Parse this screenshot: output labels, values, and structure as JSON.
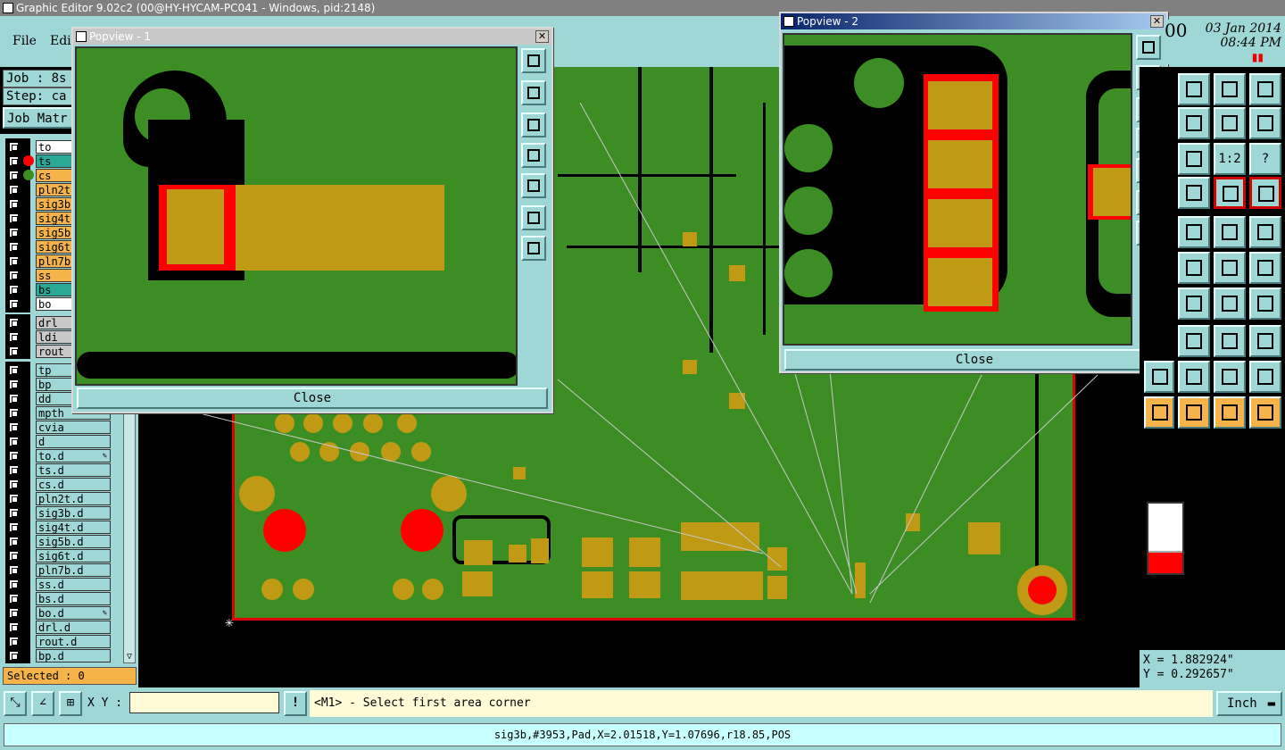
{
  "window": {
    "title": "Graphic Editor 9.02c2 (00@HY-HYCAM-PC041 - Windows, pid:2148)"
  },
  "menu": {
    "file": "File",
    "edit": "Edi"
  },
  "job": {
    "label": "Job : 8s",
    "step": "Step: ca",
    "matrix_button": "Job Matr"
  },
  "clock": {
    "prefix": "00",
    "date": "03 Jan 2014",
    "time": "08:44 PM"
  },
  "layers": [
    {
      "name": "to",
      "bg": "#ffffff",
      "dot": ""
    },
    {
      "name": "ts",
      "bg": "#2aa898",
      "dot": "#ff0000"
    },
    {
      "name": "cs",
      "bg": "#f5b34a",
      "dot": "#3c8e24"
    },
    {
      "name": "pln2t",
      "bg": "#f5b34a",
      "dot": ""
    },
    {
      "name": "sig3b",
      "bg": "#f5b34a",
      "dot": ""
    },
    {
      "name": "sig4t",
      "bg": "#f5b34a",
      "dot": ""
    },
    {
      "name": "sig5b",
      "bg": "#f5b34a",
      "dot": ""
    },
    {
      "name": "sig6t",
      "bg": "#f5b34a",
      "dot": ""
    },
    {
      "name": "pln7b",
      "bg": "#f5b34a",
      "dot": ""
    },
    {
      "name": "ss",
      "bg": "#f5b34a",
      "dot": ""
    },
    {
      "name": "bs",
      "bg": "#2aa898",
      "dot": ""
    },
    {
      "name": "bo",
      "bg": "#ffffff",
      "dot": ""
    }
  ],
  "drill_layers": [
    {
      "name": "drl",
      "bg": "#c8c8c8"
    },
    {
      "name": "ldi",
      "bg": "#c8c8c8"
    },
    {
      "name": "rout",
      "bg": "#c8c8c8"
    }
  ],
  "doc_layers": [
    {
      "name": "tp",
      "edit": false
    },
    {
      "name": "bp",
      "edit": false
    },
    {
      "name": "dd",
      "edit": false
    },
    {
      "name": "mpth",
      "edit": false
    },
    {
      "name": "cvia",
      "edit": false
    },
    {
      "name": "d",
      "edit": false
    },
    {
      "name": "to.d",
      "edit": true
    },
    {
      "name": "ts.d",
      "edit": false
    },
    {
      "name": "cs.d",
      "edit": false
    },
    {
      "name": "pln2t.d",
      "edit": false
    },
    {
      "name": "sig3b.d",
      "edit": false
    },
    {
      "name": "sig4t.d",
      "edit": false
    },
    {
      "name": "sig5b.d",
      "edit": false
    },
    {
      "name": "sig6t.d",
      "edit": false
    },
    {
      "name": "pln7b.d",
      "edit": false
    },
    {
      "name": "ss.d",
      "edit": false
    },
    {
      "name": "bs.d",
      "edit": false
    },
    {
      "name": "bo.d",
      "edit": true
    },
    {
      "name": "drl.d",
      "edit": false
    },
    {
      "name": "rout.d",
      "edit": false
    },
    {
      "name": "bp.d",
      "edit": false
    }
  ],
  "doc_layer_edit_mark": "✎",
  "selected": "Selected : 0",
  "popview1": {
    "title": "Popview - 1",
    "close": "Close"
  },
  "popview2": {
    "title": "Popview - 2",
    "close": "Close"
  },
  "close_x": "✕",
  "coords": {
    "x": "X = 1.882924\"",
    "y": "Y = 0.292657\""
  },
  "bottom": {
    "xy_label": "X Y :",
    "xy_value": "",
    "bang": "!",
    "prompt": "<M1> - Select first area corner",
    "unit": "Inch"
  },
  "status": "sig3b,#3953,Pad,X=2.01518,Y=1.07696,r18.85,POS",
  "tools_text": {
    "ratio": "1:2",
    "help": "?"
  },
  "colors": {
    "panel": "#9fd6d6",
    "board": "#3c8e24",
    "copper": "#c09a14",
    "outline": "#e00000",
    "highlight": "#ff0000"
  }
}
